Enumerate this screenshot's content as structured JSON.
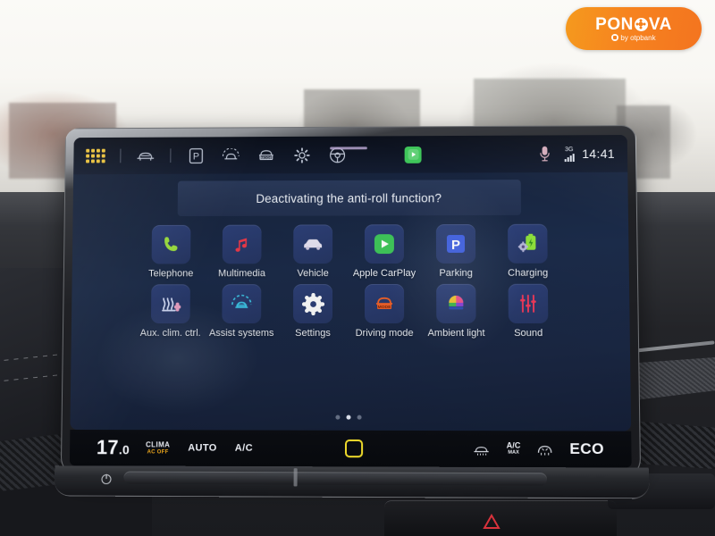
{
  "watermark": {
    "brand_main_left": "PON",
    "brand_main_right": "VA",
    "brand_sub": "by otpbank",
    "color": "#f5821f"
  },
  "status_bar": {
    "icons": [
      {
        "name": "app-grid-icon",
        "label": "Apps"
      },
      {
        "name": "car-front-icon",
        "label": "Vehicle status"
      },
      {
        "name": "parking-p-icon",
        "label": "Parking"
      },
      {
        "name": "car-assist-icon",
        "label": "Assist systems"
      },
      {
        "name": "driving-mode-icon",
        "label": "MODE"
      },
      {
        "name": "settings-gear-icon",
        "label": "Settings"
      },
      {
        "name": "steering-wheel-icon",
        "label": "Driver profile"
      }
    ],
    "carplay_indicator": "CarPlay connected",
    "microphone_icon": "microphone-icon",
    "network_label": "3G",
    "signal_bars": 4,
    "clock": "14:41"
  },
  "dialog": {
    "message": "Deactivating the anti-roll function?"
  },
  "apps": [
    {
      "label": "Telephone",
      "icon": "phone-icon",
      "color": "#9ee340"
    },
    {
      "label": "Multimedia",
      "icon": "music-note-icon",
      "color": "#ef3a4a"
    },
    {
      "label": "Vehicle",
      "icon": "car-icon",
      "color": "#e7e3f2"
    },
    {
      "label": "Apple CarPlay",
      "icon": "carplay-icon",
      "color": "#3fc65a"
    },
    {
      "label": "Parking",
      "icon": "parking-p-icon",
      "color": "#3f5fe0"
    },
    {
      "label": "Charging",
      "icon": "battery-gear-icon",
      "color": "#8ee03c"
    },
    {
      "label": "Aux. clim. ctrl.",
      "icon": "aux-climate-icon",
      "color": "#cdd7ff"
    },
    {
      "label": "Assist systems",
      "icon": "assist-car-icon",
      "color": "#3ec8e8"
    },
    {
      "label": "Settings",
      "icon": "settings-gear-icon",
      "color": "#ffffff"
    },
    {
      "label": "Driving mode",
      "icon": "driving-mode-icon",
      "color": "#f0622a"
    },
    {
      "label": "Ambient light",
      "icon": "ambient-light-icon",
      "color": "#f04f8a"
    },
    {
      "label": "Sound",
      "icon": "equalizer-icon",
      "color": "#ef3a5a"
    }
  ],
  "pager": {
    "pages": 3,
    "active_index": 1
  },
  "climate_bar": {
    "temperature": "17",
    "temperature_decimal": ".0",
    "clima_label": "CLIMA",
    "ac_off_label": "AC OFF",
    "auto_label": "AUTO",
    "ac_label": "A/C",
    "home_button": "home-square-button",
    "rear_defrost_icon": "rear-defrost-icon",
    "ac_max_label": "A/C",
    "ac_max_sub": "MAX",
    "front_defrost_icon": "front-defrost-icon",
    "eco_label": "ECO"
  },
  "hardware": {
    "power_button": "power-button",
    "speaker_grille": "speaker-grille",
    "hazard_light_button": "hazard-warning-button"
  }
}
